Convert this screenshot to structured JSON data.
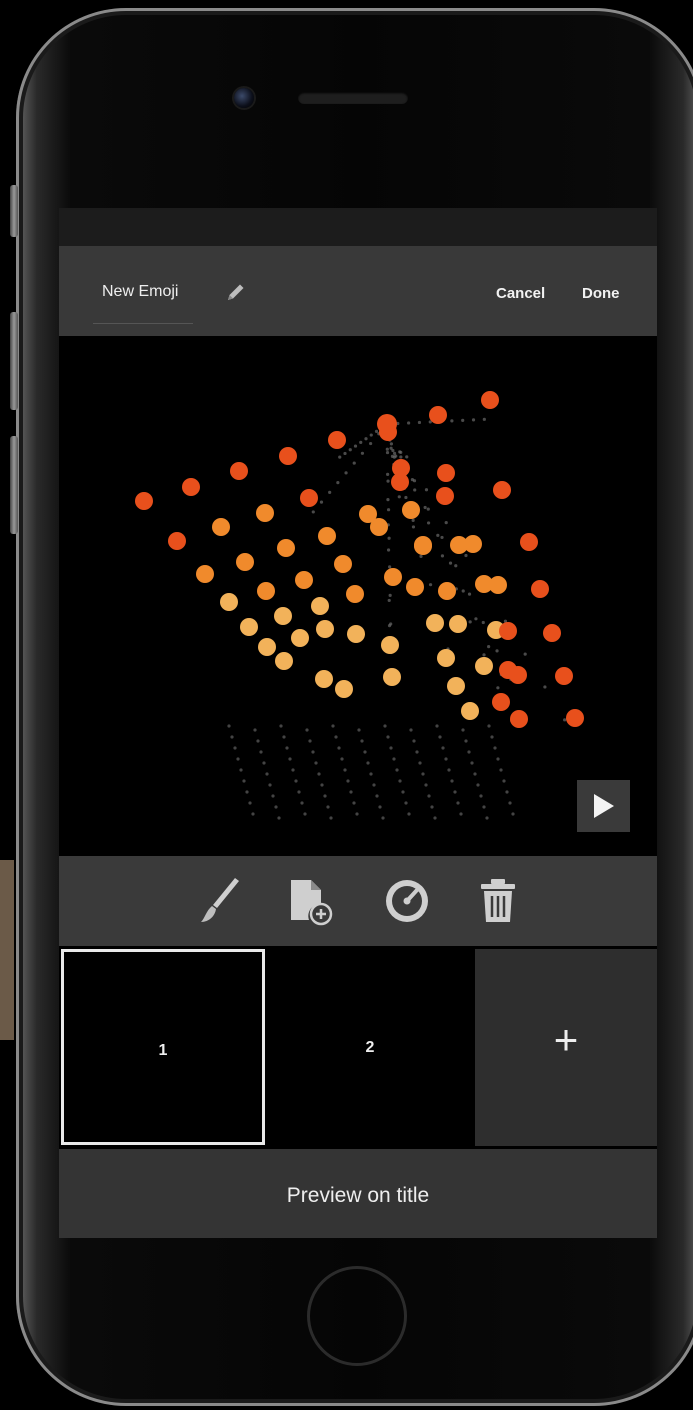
{
  "nav": {
    "title": "New Emoji",
    "cancel_label": "Cancel",
    "done_label": "Done"
  },
  "toolbar": {
    "icons": [
      "brush-icon",
      "add-file-icon",
      "speed-gauge-icon",
      "trash-icon"
    ]
  },
  "frames": [
    {
      "label": "1",
      "selected": true
    },
    {
      "label": "2",
      "selected": false
    }
  ],
  "add_frame_label": "+",
  "preview_label": "Preview on title",
  "colors": {
    "accent_orange": "#e8501c",
    "mid_orange": "#f08a2c",
    "light_orange": "#f2b25a",
    "panel": "#3a3a3a"
  }
}
